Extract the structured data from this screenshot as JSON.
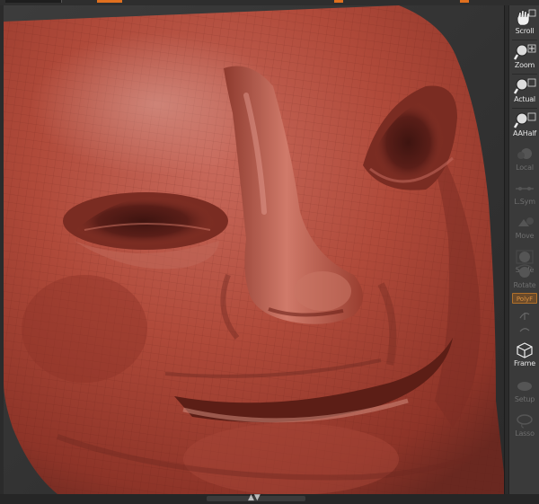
{
  "shelf": {
    "tools": [
      {
        "label": "Scroll",
        "icon": "hand-scroll-icon",
        "enabled": true
      },
      {
        "label": "Zoom",
        "icon": "magnifier-zoom-icon",
        "enabled": true
      },
      {
        "label": "Actual",
        "icon": "magnifier-actual-icon",
        "enabled": true
      },
      {
        "label": "AAHalf",
        "icon": "magnifier-aahalf-icon",
        "enabled": true
      },
      {
        "label": "Local",
        "icon": "local-icon",
        "enabled": false
      },
      {
        "label": "L.Sym",
        "icon": "local-symmetry-icon",
        "enabled": false
      },
      {
        "label": "Move",
        "icon": "move-icon",
        "enabled": false
      },
      {
        "label": "Scale",
        "icon": "scale-icon",
        "enabled": false
      },
      {
        "label": "Rotate",
        "icon": "rotate-icon",
        "enabled": false
      },
      {
        "label": "Frame",
        "icon": "frame-cube-icon",
        "enabled": true
      },
      {
        "label": "Setup",
        "icon": "setup-icon",
        "enabled": false
      },
      {
        "label": "Lasso",
        "icon": "lasso-icon",
        "enabled": false
      }
    ],
    "polyframe_label": "PolyF"
  },
  "viewport": {
    "model_color": "#b2493a"
  }
}
